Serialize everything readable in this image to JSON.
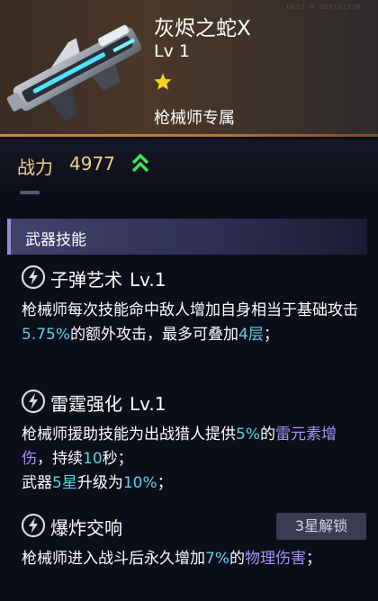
{
  "weapon": {
    "name": "灰烬之蛇X",
    "level": "Lv 1",
    "stars": 1,
    "class_tag": "枪械师专属",
    "faint_text": "UNIT-0 DEFLECTOR"
  },
  "power": {
    "label": "战力",
    "value": "4977",
    "trend_icon": "double-chevron-up-icon"
  },
  "section": {
    "title": "武器技能"
  },
  "skills": [
    {
      "icon": "lightning-icon",
      "name": "子弹艺术",
      "level": "Lv.1",
      "desc": {
        "t1": "枪械师每次技能命中敌人增加自身相当于基础攻击",
        "v1": "5.75%",
        "t2": "的额外攻击，最多可叠加",
        "v2": "4层",
        "t3": "；"
      }
    },
    {
      "icon": "lightning-icon",
      "name": "雷霆强化",
      "level": "Lv.1",
      "desc": {
        "t1": "枪械师援助技能为出战猎人提供",
        "v1": "5%",
        "t2": "的",
        "v2": "雷元素增伤",
        "t3": "，持续",
        "v3": "10",
        "t4": "秒；",
        "t5": "武器",
        "v4": "5星",
        "t6": "升级为",
        "v5": "10%",
        "t7": "；"
      }
    },
    {
      "icon": "lightning-icon",
      "name": "爆炸交响",
      "lock_label": "3星解锁",
      "desc": {
        "t1": "枪械师进入战斗后永久增加",
        "v1": "7%",
        "t2": "的",
        "v2": "物理伤害",
        "t3": "；"
      }
    }
  ],
  "colors": {
    "highlight": "#58d3e6",
    "element": "#a893f5",
    "power": "#f2cf86",
    "star": "#f3d51f",
    "arrow": "#3ee05a"
  }
}
